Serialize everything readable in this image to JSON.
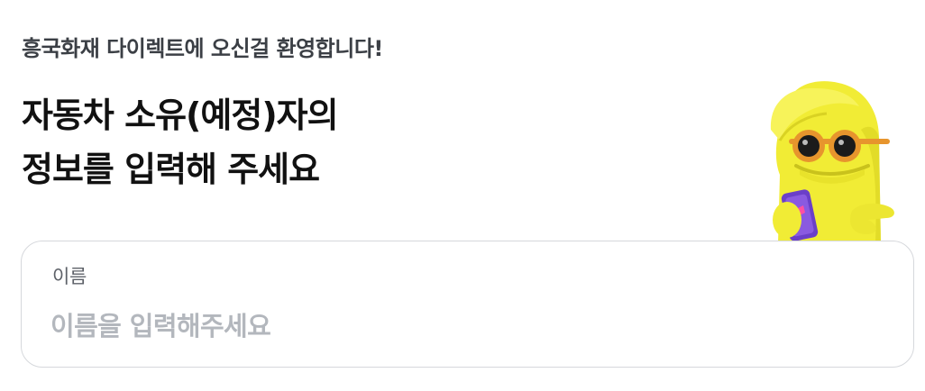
{
  "greeting": "흥국화재 다이렉트에 오신걸 환영합니다!",
  "heading": {
    "line1": "자동차 소유(예정)자의",
    "line2": "정보를 입력해 주세요"
  },
  "mascot": {
    "icon": "mascot-with-phone",
    "colors": {
      "body": "#f3ef3a",
      "glasses": "#e7952d",
      "phone": "#6b3fc8"
    }
  },
  "name_field": {
    "label": "이름",
    "value": "",
    "placeholder": "이름을 입력해주세요"
  }
}
